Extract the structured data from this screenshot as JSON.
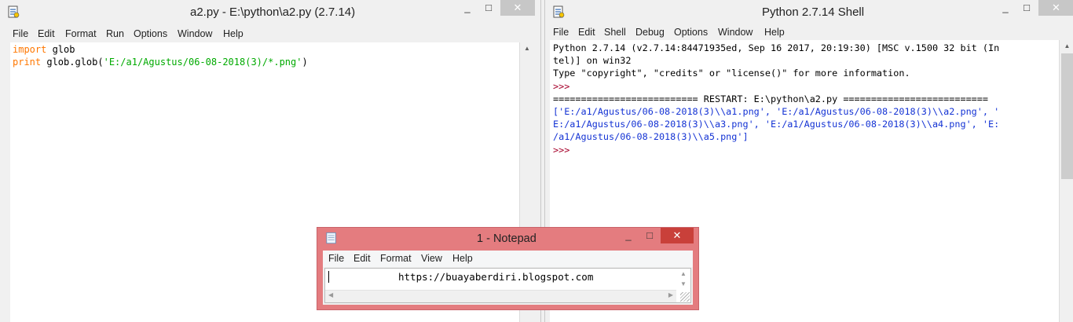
{
  "editor_window": {
    "title": "a2.py - E:\\python\\a2.py (2.7.14)",
    "menu": [
      "File",
      "Edit",
      "Format",
      "Run",
      "Options",
      "Window",
      "Help"
    ],
    "code": {
      "line1_keyword": "import",
      "line1_rest": " glob",
      "line2_keyword": "print",
      "line2_mid": " glob.glob(",
      "line2_string": "'E:/a1/Agustus/06-08-2018(3)/*.png'",
      "line2_end": ")"
    },
    "controls": {
      "minimize": "_",
      "maximize": "□",
      "close": "✕"
    }
  },
  "shell_window": {
    "title": "Python 2.7.14 Shell",
    "menu": [
      "File",
      "Edit",
      "Shell",
      "Debug",
      "Options",
      "Window",
      "Help"
    ],
    "lines": {
      "banner1": "Python 2.7.14 (v2.7.14:84471935ed, Sep 16 2017, 20:19:30) [MSC v.1500 32 bit (In",
      "banner2": "tel)] on win32",
      "banner3": "Type \"copyright\", \"credits\" or \"license()\" for more information.",
      "prompt": ">>>",
      "restart": "========================== RESTART: E:\\python\\a2.py ==========================",
      "out1": "['E:/a1/Agustus/06-08-2018(3)\\\\a1.png', 'E:/a1/Agustus/06-08-2018(3)\\\\a2.png', '",
      "out2": "E:/a1/Agustus/06-08-2018(3)\\\\a3.png', 'E:/a1/Agustus/06-08-2018(3)\\\\a4.png', 'E:",
      "out3": "/a1/Agustus/06-08-2018(3)\\\\a5.png']"
    },
    "controls": {
      "minimize": "_",
      "maximize": "□",
      "close": "✕"
    }
  },
  "notepad_window": {
    "title": "1 - Notepad",
    "menu": [
      "File",
      "Edit",
      "Format",
      "View",
      "Help"
    ],
    "content": "https://buayaberdiri.blogspot.com",
    "controls": {
      "minimize": "_",
      "maximize": "□",
      "close": "✕"
    },
    "accent_color": "#e47c7f",
    "close_color": "#c9403a"
  },
  "scroll_arrows": {
    "up": "▲",
    "down": "▼",
    "left": "◀",
    "right": "▶"
  }
}
